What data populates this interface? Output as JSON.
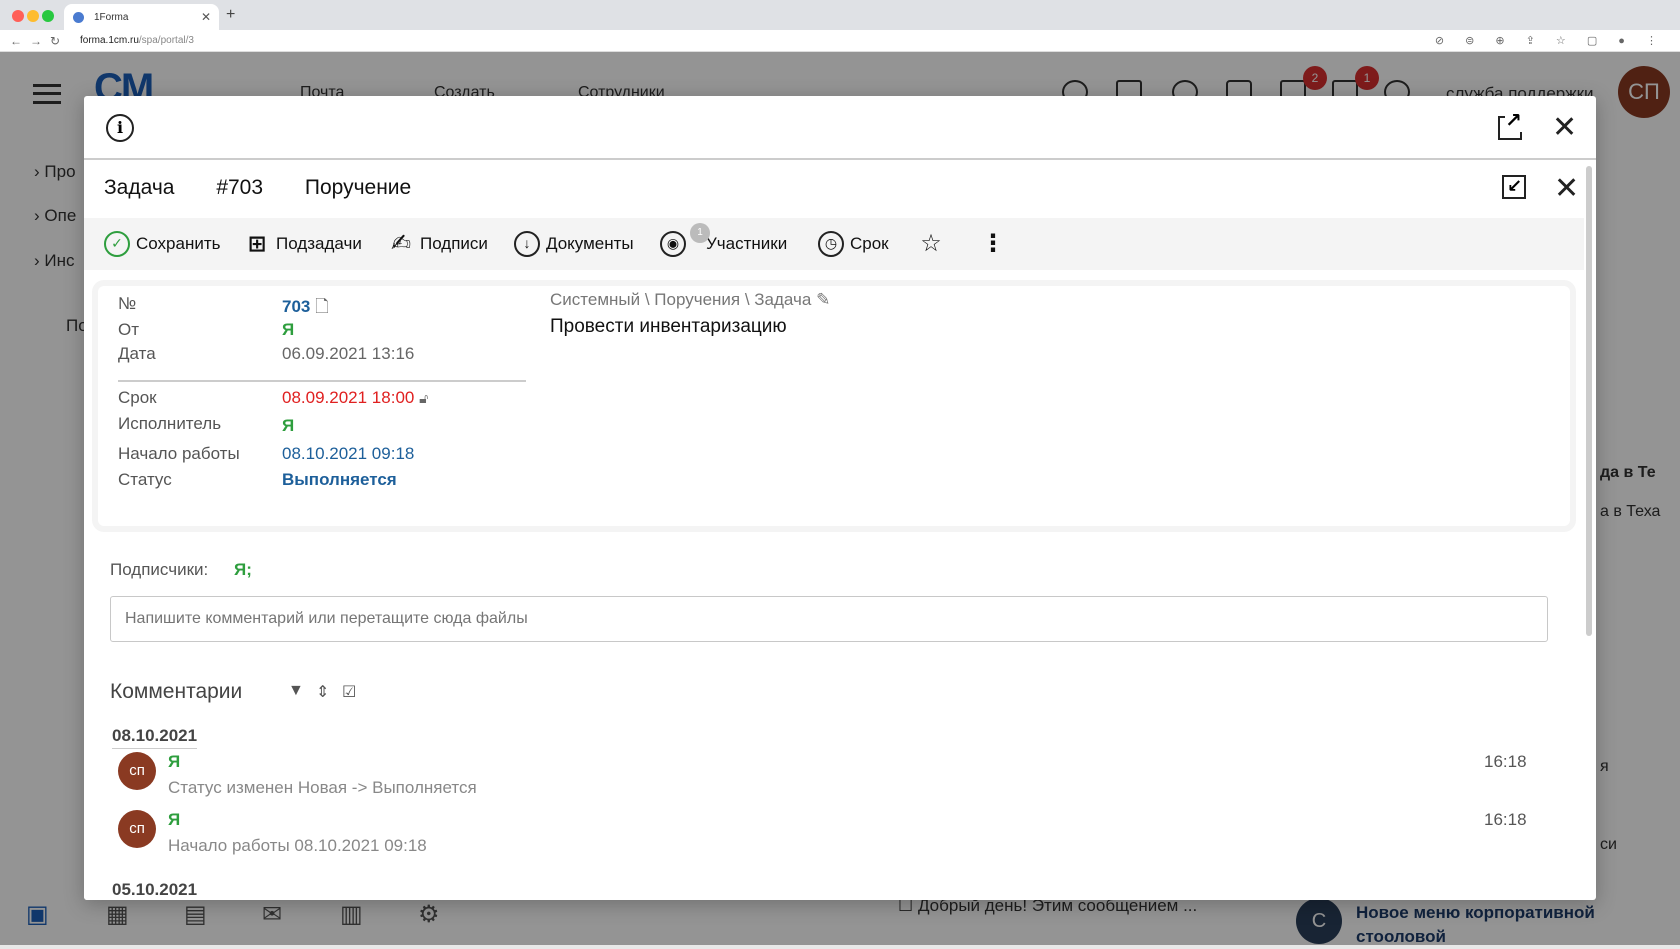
{
  "browser": {
    "tab_title": "1Forma",
    "url_host": "forma.1cm.ru",
    "url_path": "/spa/portal/3"
  },
  "background_app": {
    "logo": "CM",
    "nav": [
      "Почта",
      "Создать",
      "Сотрудники"
    ],
    "badges": [
      "2",
      "1"
    ],
    "support_label": "служба поддержки",
    "avatar_initials": "СП",
    "side_items": [
      "Про",
      "Опе",
      "Инс",
      "По"
    ],
    "right_text": [
      "да в Те",
      "а в Теха",
      "я",
      "си"
    ],
    "message_preview": "Добрый день! Этим сообщением ...",
    "news_title": "Новое меню корпоративной стооловой",
    "news_avatar": "С"
  },
  "modal": {
    "close_symbol": "✕"
  },
  "task": {
    "type": "Задача",
    "number_label": "#703",
    "kind": "Поручение",
    "toolbar": {
      "save": "Сохранить",
      "subtasks": "Подзадачи",
      "signatures": "Подписи",
      "documents": "Документы",
      "participants": "Участники",
      "participants_count": "1",
      "deadline": "Срок"
    },
    "fields": {
      "number_label": "№",
      "number_value": "703",
      "from_label": "От",
      "from_value": "Я",
      "date_label": "Дата",
      "date_value": "06.09.2021 13:16",
      "deadline_label": "Срок",
      "deadline_value": "08.09.2021 18:00",
      "executor_label": "Исполнитель",
      "executor_value": "Я",
      "start_label": "Начало работы",
      "start_value": "08.10.2021 09:18",
      "status_label": "Статус",
      "status_value": "Выполняется"
    },
    "breadcrumb": "Системный \\ Поручения \\ Задача",
    "title": "Провести инвентаризацию",
    "subscribers_label": "Подписчики:",
    "subscribers_value": "Я;",
    "comment_placeholder": "Напишите комментарий или перетащите сюда файлы",
    "comments_title": "Комментарии",
    "comments": [
      {
        "date": "08.10.2021",
        "items": [
          {
            "initials": "сп",
            "author": "Я",
            "text": "Статус изменен Новая -> Выполняется",
            "time": "16:18"
          },
          {
            "initials": "сп",
            "author": "Я",
            "text": "Начало работы 08.10.2021 09:18",
            "time": "16:18"
          }
        ]
      },
      {
        "date": "05.10.2021",
        "items": []
      }
    ]
  },
  "colors": {
    "accent_green": "#2e9e3e",
    "link_blue": "#1d5f9a",
    "overdue_red": "#e02020",
    "avatar_brown": "#8a3a22"
  }
}
